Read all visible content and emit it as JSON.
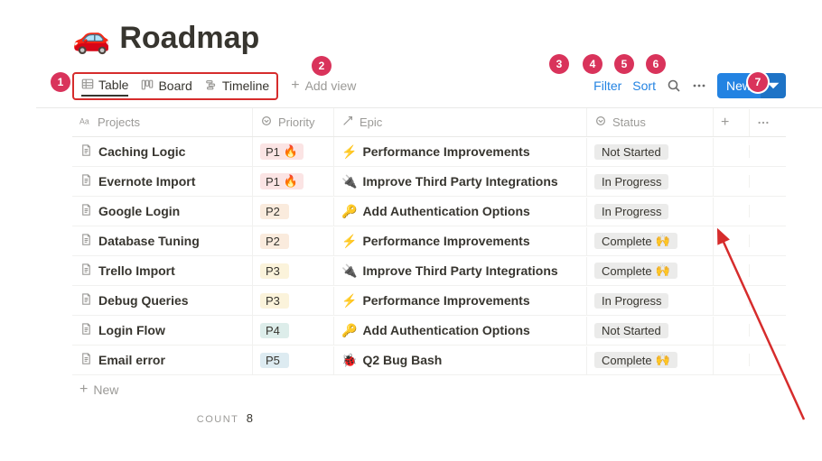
{
  "title_icon": "🚗",
  "title": "Roadmap",
  "views": {
    "table": "Table",
    "board": "Board",
    "timeline": "Timeline"
  },
  "add_view": "Add view",
  "controls": {
    "filter": "Filter",
    "sort": "Sort",
    "new": "New"
  },
  "columns": {
    "projects": "Projects",
    "priority": "Priority",
    "epic": "Epic",
    "status": "Status"
  },
  "priority_palette": {
    "P1": "#fbe4e4",
    "P2": "#faebdd",
    "P3": "#fbf3db",
    "P4": "#ddedea",
    "P5": "#ddebf1"
  },
  "epic_icons": {
    "perf": "⚡",
    "integrations": "🔌",
    "auth": "🔑",
    "bug": "🐞"
  },
  "status_icons": {
    "complete": "🙌"
  },
  "rows": [
    {
      "name": "Caching Logic",
      "priority": "P1",
      "p_emoji": "🔥",
      "epic": "perf",
      "epic_label": "Performance Improvements",
      "status": "Not Started"
    },
    {
      "name": "Evernote Import",
      "priority": "P1",
      "p_emoji": "🔥",
      "epic": "integrations",
      "epic_label": "Improve Third Party Integrations",
      "status": "In Progress"
    },
    {
      "name": "Google Login",
      "priority": "P2",
      "p_emoji": "",
      "epic": "auth",
      "epic_label": "Add Authentication Options",
      "status": "In Progress"
    },
    {
      "name": "Database Tuning",
      "priority": "P2",
      "p_emoji": "",
      "epic": "perf",
      "epic_label": "Performance Improvements",
      "status": "Complete"
    },
    {
      "name": "Trello Import",
      "priority": "P3",
      "p_emoji": "",
      "epic": "integrations",
      "epic_label": "Improve Third Party Integrations",
      "status": "Complete"
    },
    {
      "name": "Debug Queries",
      "priority": "P3",
      "p_emoji": "",
      "epic": "perf",
      "epic_label": "Performance Improvements",
      "status": "In Progress"
    },
    {
      "name": "Login Flow",
      "priority": "P4",
      "p_emoji": "",
      "epic": "auth",
      "epic_label": "Add Authentication Options",
      "status": "Not Started"
    },
    {
      "name": "Email error",
      "priority": "P5",
      "p_emoji": "",
      "epic": "bug",
      "epic_label": "Q2 Bug Bash",
      "status": "Complete"
    }
  ],
  "add_row": "New",
  "count_label": "COUNT",
  "count_value": "8",
  "annotations": [
    "1",
    "2",
    "3",
    "4",
    "5",
    "6",
    "7"
  ]
}
